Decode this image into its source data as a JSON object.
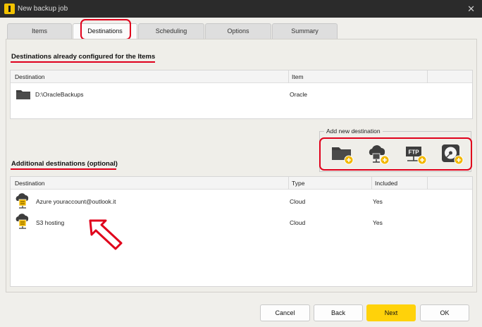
{
  "window": {
    "title": "New backup job",
    "icon": "app-logo-icon",
    "close_icon": "close-icon"
  },
  "tabs": [
    {
      "label": "Items"
    },
    {
      "label": "Destinations",
      "active": true
    },
    {
      "label": "Scheduling"
    },
    {
      "label": "Options"
    },
    {
      "label": "Summary"
    }
  ],
  "configured": {
    "title": "Destinations already configured for the Items",
    "columns": [
      "Destination",
      "Item"
    ],
    "rows": [
      {
        "icon": "folder-icon",
        "destination": "D:\\OracleBackups",
        "item": "Oracle"
      }
    ]
  },
  "add_new": {
    "label": "Add new destination",
    "buttons": [
      {
        "icon": "add-folder-icon"
      },
      {
        "icon": "add-cloud-icon"
      },
      {
        "icon": "add-ftp-icon",
        "text": "FTP"
      },
      {
        "icon": "add-disk-icon"
      }
    ]
  },
  "additional": {
    "title": "Additional destinations (optional)",
    "columns": [
      "Destination",
      "Type",
      "Included"
    ],
    "rows": [
      {
        "icon": "cloud-server-icon",
        "destination": "Azure youraccount@outlook.it",
        "type": "Cloud",
        "included": "Yes"
      },
      {
        "icon": "cloud-server-icon",
        "destination": "S3 hosting",
        "type": "Cloud",
        "included": "Yes"
      }
    ]
  },
  "footer": {
    "cancel": "Cancel",
    "back": "Back",
    "next": "Next",
    "ok": "OK"
  },
  "colors": {
    "accent": "#ffd20a",
    "highlight": "#e0001b",
    "titlebar": "#2b2b2b"
  }
}
